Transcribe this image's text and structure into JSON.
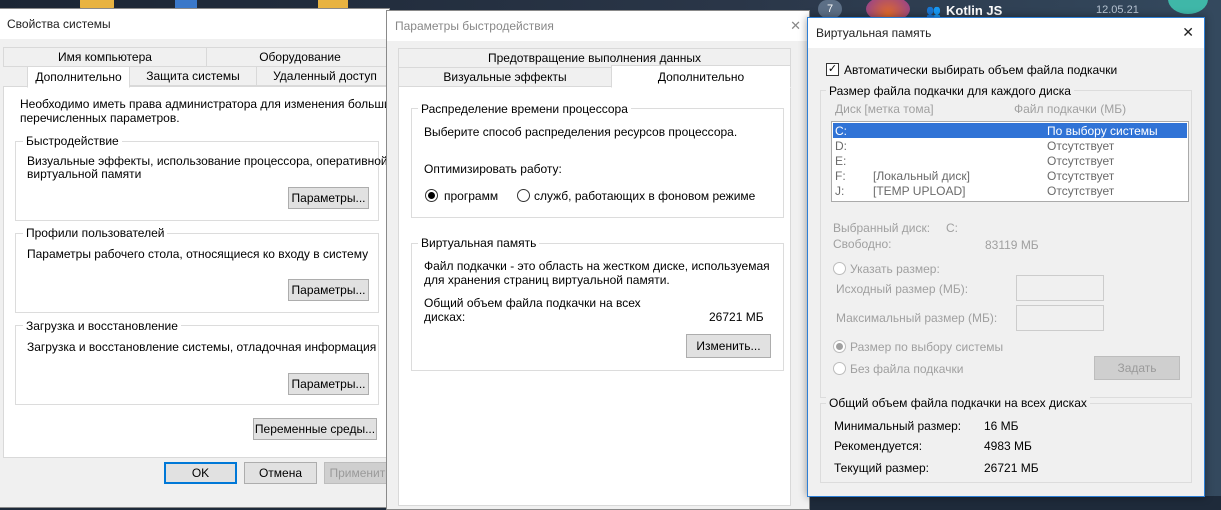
{
  "taskbar": {
    "app_name": "Kotlin JS",
    "date": "12.05.21",
    "badge_count": "7"
  },
  "sysprops": {
    "title": "Свойства системы",
    "tabs_row1": [
      "Имя компьютера",
      "Оборудование"
    ],
    "tabs_row2": [
      "Дополнительно",
      "Защита системы",
      "Удаленный доступ"
    ],
    "admin_note_1": "Необходимо иметь права администратора для изменения большинства",
    "admin_note_2": "перечисленных параметров.",
    "perf_title": "Быстродействие",
    "perf_desc_1": "Визуальные эффекты, использование процессора, оперативной и",
    "perf_desc_2": "виртуальной памяти",
    "params_label": "Параметры...",
    "profiles_title": "Профили пользователей",
    "profiles_desc": "Параметры рабочего стола, относящиеся ко входу в систему",
    "boot_title": "Загрузка и восстановление",
    "boot_desc": "Загрузка и восстановление системы, отладочная информация",
    "env_label": "Переменные среды...",
    "ok_label": "OK",
    "cancel_label": "Отмена",
    "apply_label": "Применить"
  },
  "perfopts": {
    "title": "Параметры быстродействия",
    "tab_dep": "Предотвращение выполнения данных",
    "tab_visual": "Визуальные эффекты",
    "tab_advanced": "Дополнительно",
    "cpu_title": "Распределение времени процессора",
    "cpu_desc": "Выберите способ распределения ресурсов процессора.",
    "optimize_label": "Оптимизировать работу:",
    "radio_programs": "программ",
    "radio_services": "служб, работающих в фоновом режиме",
    "vm_title": "Виртуальная память",
    "vm_desc_1": "Файл подкачки - это область на жестком диске, используемая",
    "vm_desc_2": "для хранения страниц виртуальной памяти.",
    "vm_total_1": "Общий объем файла подкачки на всех",
    "vm_total_2": "дисках:",
    "vm_total_value": "26721 МБ",
    "change_label": "Изменить..."
  },
  "vm": {
    "title": "Виртуальная память",
    "close_glyph": "✕",
    "auto_label": "Автоматически выбирать объем файла подкачки",
    "auto_checked": true,
    "group_title": "Размер файла подкачки для каждого диска",
    "col_disk": "Диск [метка тома]",
    "col_size": "Файл подкачки (МБ)",
    "disks": [
      {
        "letter": "C:",
        "label": "",
        "size": "По выбору системы",
        "selected": true
      },
      {
        "letter": "D:",
        "label": "",
        "size": "Отсутствует",
        "selected": false
      },
      {
        "letter": "E:",
        "label": "",
        "size": "Отсутствует",
        "selected": false
      },
      {
        "letter": "F:",
        "label": "[Локальный диск]",
        "size": "Отсутствует",
        "selected": false
      },
      {
        "letter": "J:",
        "label": "[TEMP UPLOAD]",
        "size": "Отсутствует",
        "selected": false
      }
    ],
    "selected_disk_label": "Выбранный диск:",
    "selected_disk_value": "C:",
    "free_label": "Свободно:",
    "free_value": "83119 МБ",
    "custom_size_label": "Указать размер:",
    "initial_size_label": "Исходный размер (МБ):",
    "max_size_label": "Максимальный размер (МБ):",
    "system_size_label": "Размер по выбору системы",
    "no_file_label": "Без файла подкачки",
    "set_label": "Задать",
    "total_group_title": "Общий объем файла подкачки на всех дисках",
    "min_label": "Минимальный размер:",
    "min_value": "16 МБ",
    "rec_label": "Рекомендуется:",
    "rec_value": "4983 МБ",
    "cur_label": "Текущий размер:",
    "cur_value": "26721 МБ"
  }
}
